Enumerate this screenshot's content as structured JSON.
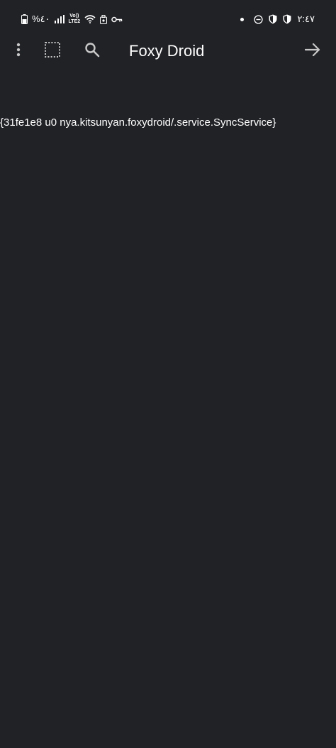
{
  "status_bar": {
    "battery_percent": "%٤٠",
    "volte_top": "Vo))",
    "volte_bottom": "LTE2",
    "time": "٢:٤٧"
  },
  "toolbar": {
    "title": "Foxy Droid",
    "menu_icon": "more-vert-icon",
    "select_icon": "select-all-icon",
    "search_icon": "search-icon",
    "forward_icon": "arrow-forward-icon"
  },
  "content": {
    "service_text": "{31fe1e8 u0 nya.kitsunyan.foxydroid/.service.SyncService}"
  },
  "colors": {
    "background": "#212226",
    "foreground": "#ffffff",
    "icon": "#c8c8c8"
  }
}
